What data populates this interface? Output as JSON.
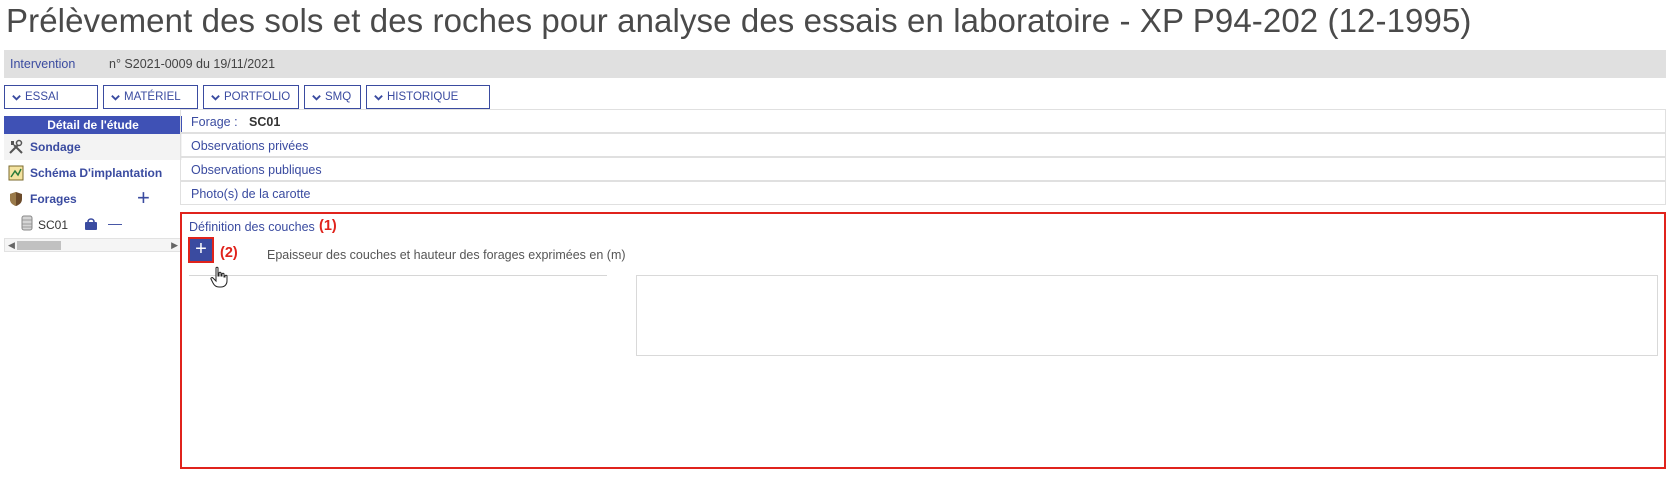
{
  "page": {
    "title": "Prélèvement des sols et des roches pour analyse des essais en laboratoire - XP P94-202 (12-1995)"
  },
  "intervention": {
    "label": "Intervention",
    "value": "n° S2021-0009 du 19/11/2021"
  },
  "toolbar": {
    "buttons": [
      {
        "label": "ESSAI",
        "icon": "chevron-down-icon"
      },
      {
        "label": "MATÉRIEL",
        "icon": "chevron-down-icon"
      },
      {
        "label": "PORTFOLIO",
        "icon": "chevron-down-icon"
      },
      {
        "label": "SMQ",
        "icon": "chevron-down-icon"
      },
      {
        "label": "HISTORIQUE",
        "icon": "chevron-down-icon"
      }
    ]
  },
  "sidebar": {
    "header": "Détail de l'étude",
    "items": [
      {
        "label": "Sondage",
        "icon": "tools-icon"
      },
      {
        "label": "Schéma D'implantation",
        "icon": "map-icon"
      },
      {
        "label": "Forages",
        "icon": "shield-icon",
        "add": "+"
      }
    ],
    "children": [
      {
        "label": "SC01",
        "icon": "core-sample-icon",
        "action_icon": "bag-icon",
        "remove": "—"
      }
    ]
  },
  "main": {
    "forage_label": "Forage :",
    "forage_value": "SC01",
    "sections": [
      "Observations privées",
      "Observations publiques",
      "Photo(s) de la carotte"
    ],
    "layers": {
      "title": "Définition des couches",
      "annotation_1": "(1)",
      "add_button": "+",
      "annotation_2": "(2)",
      "units_text": "Epaisseur des couches et hauteur des forages exprimées en (m)"
    }
  },
  "colors": {
    "accent": "#3f51b5",
    "highlight": "#e0231c",
    "bar": "#e0e0e0"
  }
}
